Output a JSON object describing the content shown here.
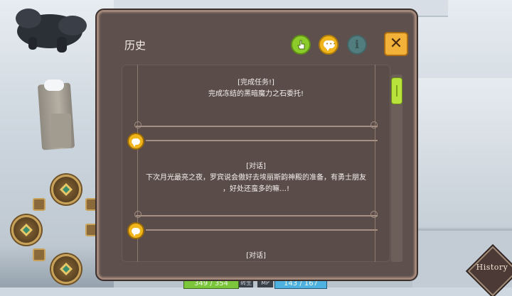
{
  "dialog": {
    "title": "历史",
    "buttons": {
      "filter_all": "hand-pointer-icon",
      "filter_chat": "chat-bubble-icon",
      "info": "i",
      "close": "✕"
    }
  },
  "entries": [
    {
      "label": "[完成任务!]",
      "text": "完成冻结的黑暗魔力之石委托!"
    },
    {
      "label": "[对话]",
      "text_line1": "下次月光最亮之夜，罗宾说会傲好去埃丽斯韵神殿的准备，有勇士朋友",
      "text_line2": "，好处还蛮多的嘛…!"
    },
    {
      "label": "[对话]"
    }
  ],
  "status": {
    "hp": "349 / 354",
    "hp_label": "转生",
    "mp_label": "MP",
    "mp": "143 / 167"
  },
  "history_button": "History",
  "colors": {
    "dialog_bg": "#5e504c",
    "accent_green": "#8ccc2a",
    "accent_yellow": "#f1b51c",
    "close_orange": "#f2b23a",
    "hp_green": "#7cc63c",
    "mp_blue": "#4fb1e0"
  }
}
